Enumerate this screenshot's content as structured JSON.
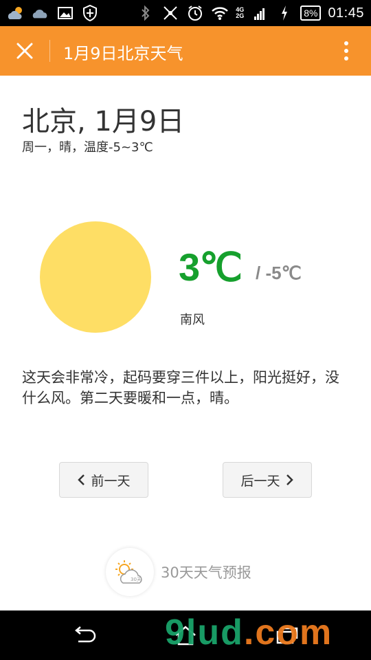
{
  "status_bar": {
    "time": "01:45",
    "battery": "8%",
    "network_top": "4G",
    "network_bottom": "2G",
    "icons": [
      "weather-cloud-sun-icon",
      "cloud-icon",
      "image-icon",
      "shield-icon",
      "bluetooth-icon",
      "mute-icon",
      "alarm-icon",
      "wifi-icon",
      "signal-icon",
      "charging-icon"
    ]
  },
  "app_bar": {
    "title": "1月9日北京天气",
    "close_icon": "close-icon",
    "more_icon": "more-vertical-icon",
    "background": "#f7932c"
  },
  "weather": {
    "city_date": "北京, 1月9日",
    "summary": "周一，晴，温度-5~3℃",
    "condition_icon": "sun-icon",
    "high": "3℃",
    "low": "/ -5℃",
    "wind": "南风",
    "description": "这天会非常冷，起码要穿三件以上，阳光挺好，没什么风。第二天要暖和一点，晴。",
    "high_color": "#16a02d",
    "sun_color": "#fede65"
  },
  "navigation": {
    "prev_label": "前一天",
    "next_label": "后一天"
  },
  "forecast": {
    "icon_label": "30天",
    "label": "30天天气预报"
  },
  "system_nav": {
    "back_icon": "back-icon",
    "home_icon": "home-icon",
    "recents_icon": "recents-icon"
  },
  "watermark": {
    "main": "9lud",
    "suffix": ".com"
  }
}
